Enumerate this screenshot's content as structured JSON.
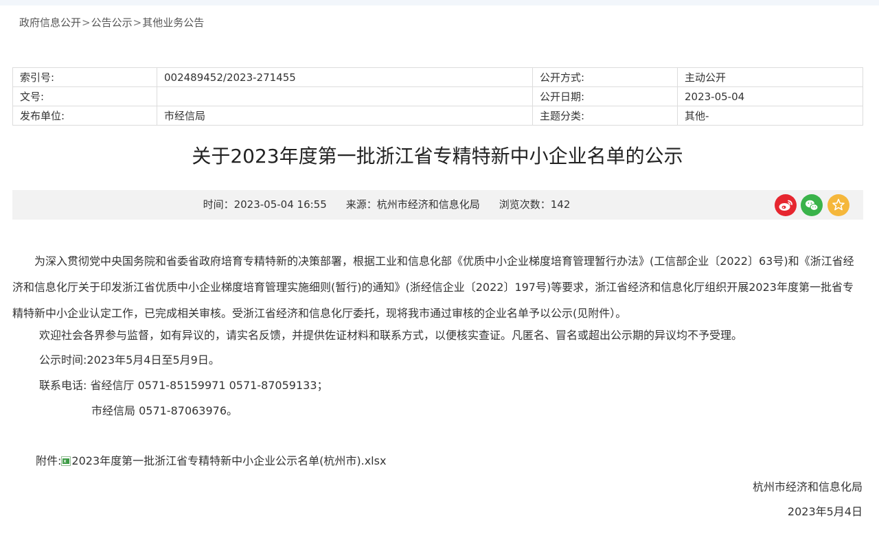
{
  "breadcrumb": {
    "item1": "政府信息公开",
    "item2": "公告公示",
    "item3": "其他业务公告",
    "separator": ">"
  },
  "meta": {
    "index_label": "索引号:",
    "index_value": "002489452/2023-271455",
    "method_label": "公开方式:",
    "method_value": "主动公开",
    "doc_no_label": "文号:",
    "doc_no_value": "",
    "date_label": "公开日期:",
    "date_value": "2023-05-04",
    "publisher_label": "发布单位:",
    "publisher_value": "市经信局",
    "category_label": "主题分类:",
    "category_value": "其他-"
  },
  "article": {
    "title": "关于2023年度第一批浙江省专精特新中小企业名单的公示",
    "time": "时间：2023-05-04 16:55",
    "source": "来源：杭州市经济和信息化局",
    "views": "浏览次数：142"
  },
  "share": {
    "weibo_icon": "weibo-icon",
    "wechat_icon": "wechat-icon",
    "favorite_icon": "star-icon",
    "colors": {
      "weibo": "#e6262f",
      "wechat": "#3ab34a",
      "favorite": "#f5b73b"
    }
  },
  "body": {
    "p1": "　　为深入贯彻党中央国务院和省委省政府培育专精特新的决策部署，根据工业和信息化部《优质中小企业梯度培育管理暂行办法》(工信部企业〔2022〕63号)和《浙江省经济和信息化厅关于印发浙江省优质中小企业梯度培育管理实施细则(暂行)的通知》(浙经信企业〔2022〕197号)等要求，浙江省经济和信息化厅组织开展2023年度第一批省专精特新中小企业认定工作，已完成相关审核。受浙江省经济和信息化厅委托，现将我市通过审核的企业名单予以公示(见附件）。",
    "p2": "欢迎社会各界参与监督，如有异议的，请实名反馈，并提供佐证材料和联系方式，以便核实查证。凡匿名、冒名或超出公示期的异议均不予受理。",
    "p3": "公示时间:2023年5月4日至5月9日。",
    "p4": "联系电话: 省经信厅 0571-85159971 0571-87059133；",
    "p5": "市经信局 0571-87063976。",
    "attachment_label": "附件:",
    "attachment_name": "2023年度第一批浙江省专精特新中小企业公示名单(杭州市).xlsx",
    "signature": "杭州市经济和信息化局",
    "sign_date": "2023年5月4日"
  }
}
